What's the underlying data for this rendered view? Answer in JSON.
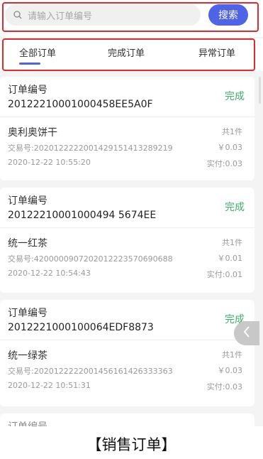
{
  "search": {
    "placeholder": "请输入订单编号",
    "button_label": "搜索"
  },
  "tabs": [
    {
      "label": "全部订单",
      "active": true
    },
    {
      "label": "完成订单",
      "active": false
    },
    {
      "label": "异常订单",
      "active": false
    }
  ],
  "orders": [
    {
      "order_label": "订单编号",
      "order_number": "20122210001000458EE5A0F",
      "status": "完成",
      "product": "奥利奥饼干",
      "transaction": "交易号:2020122222001429151413289219",
      "time": "2020-12-22 10:55:20",
      "quantity": "共1件",
      "price": "￥0.03",
      "paid": "实付:0.03"
    },
    {
      "order_label": "订单编号",
      "order_number": "20122210001000494 5674EE",
      "status": "完成",
      "product": "统一红茶",
      "transaction": "交易号:4200000907202012223570690688",
      "time": "2020-12-22 10:54:43",
      "quantity": "共1件",
      "price": "￥0.01",
      "paid": "实付:0.01"
    },
    {
      "order_label": "订单编号",
      "order_number": "2012221000100064EDF8873",
      "status": "完成",
      "product": "统一绿茶",
      "transaction": "交易号:2020122222001456161426333363",
      "time": "2020-12-22 10:51:31",
      "quantity": "共1件",
      "price": "￥0.03",
      "paid": "实付:0.03"
    }
  ],
  "partial_label": "订单编号",
  "caption": "【销售订单】",
  "colors": {
    "accent": "#4f63e7",
    "status": "#3dae6b",
    "highlight_box": "#e02a2a"
  },
  "icons": {
    "search": "search-icon",
    "back": "chevron-left-icon"
  }
}
